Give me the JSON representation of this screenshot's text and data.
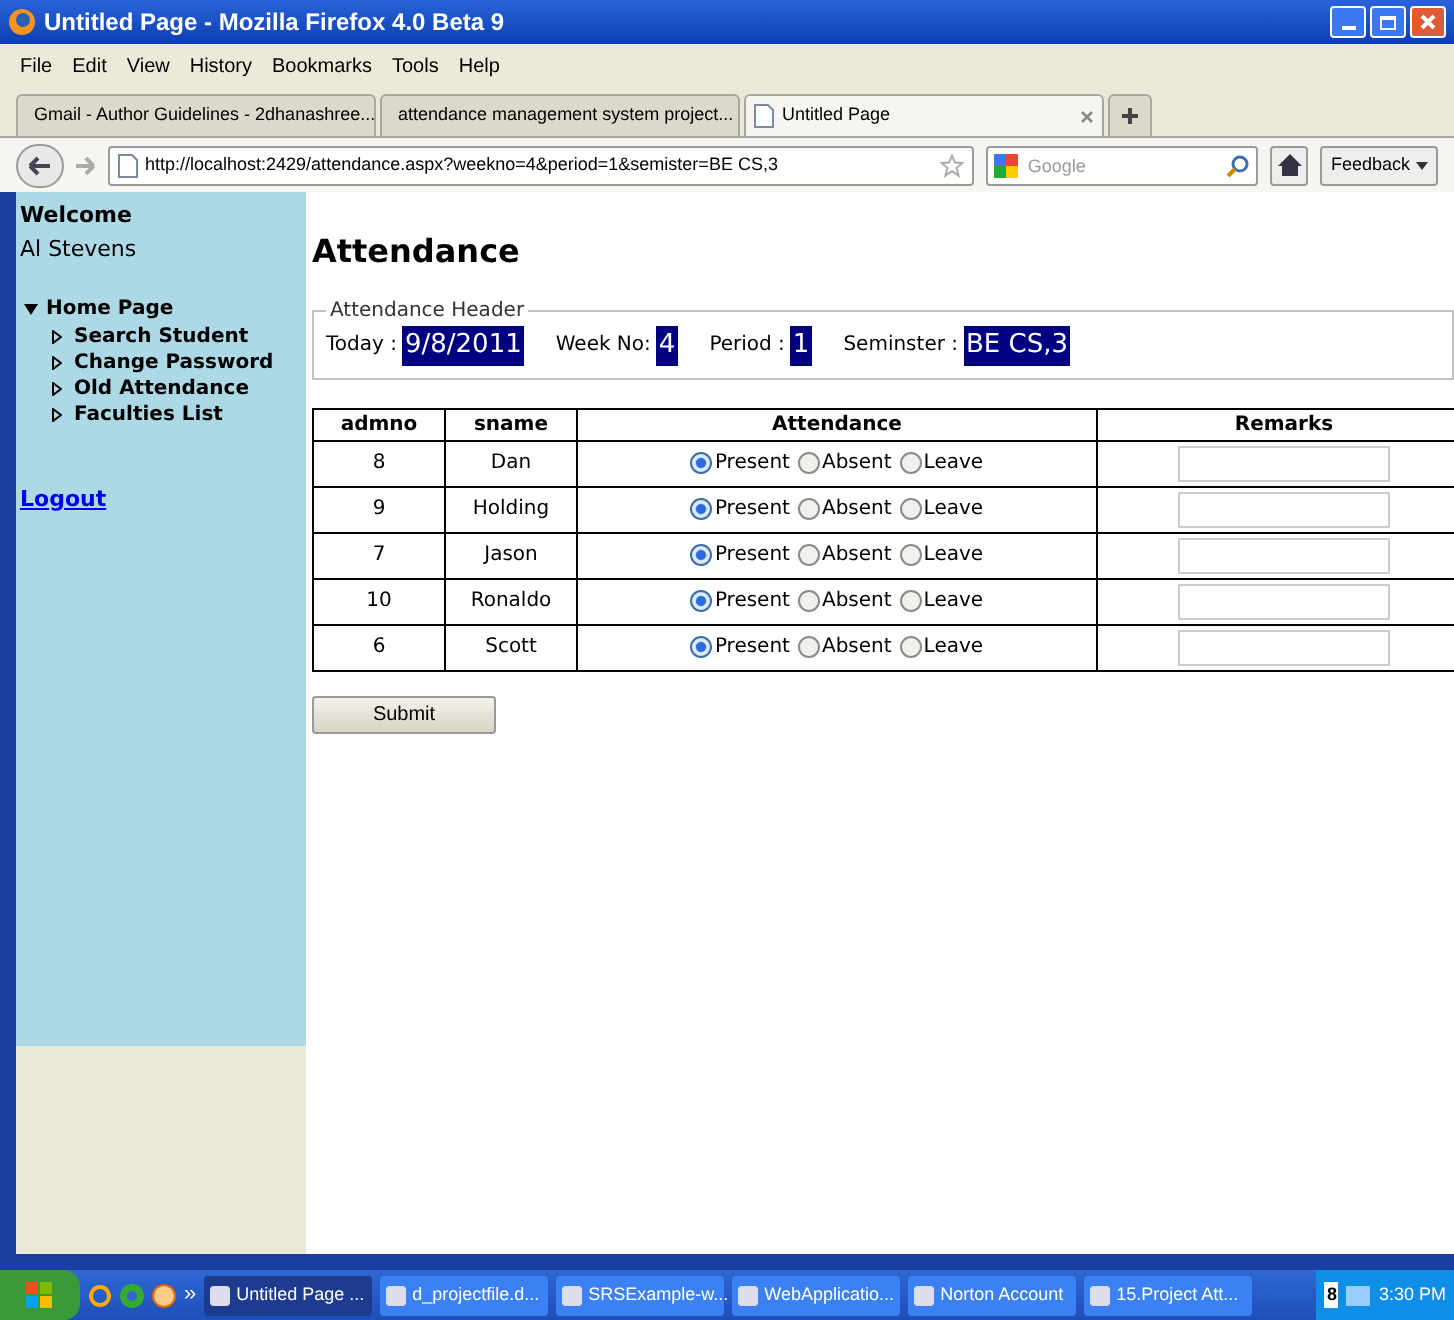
{
  "window": {
    "title": "Untitled Page - Mozilla Firefox 4.0 Beta 9"
  },
  "menu": [
    "File",
    "Edit",
    "View",
    "History",
    "Bookmarks",
    "Tools",
    "Help"
  ],
  "tabs": [
    {
      "label": "Gmail - Author Guidelines - 2dhanashree...",
      "selected": false
    },
    {
      "label": "attendance management system project...",
      "selected": false
    },
    {
      "label": "Untitled Page",
      "selected": true
    }
  ],
  "address": "http://localhost:2429/attendance.aspx?weekno=4&period=1&semister=BE CS,3",
  "search": {
    "placeholder": "Google"
  },
  "feedback": "Feedback",
  "sidebar": {
    "welcome": "Welcome",
    "user": "Al Stevens",
    "root": {
      "label": "Home Page",
      "expanded": true,
      "children": [
        "Search Student",
        "Change Password",
        "Old Attendance",
        "Faculties List"
      ]
    },
    "logout": "Logout"
  },
  "heading": "Attendance",
  "header_box": {
    "legend": "Attendance Header",
    "fields": [
      {
        "label": "Today :",
        "value": "9/8/2011"
      },
      {
        "label": "Week No:",
        "value": "4"
      },
      {
        "label": "Period :",
        "value": "1"
      },
      {
        "label": "Seminster :",
        "value": "BE CS,3"
      }
    ]
  },
  "table": {
    "columns": [
      "admno",
      "sname",
      "Attendance",
      "Remarks"
    ],
    "rows": [
      {
        "admno": "8",
        "sname": "Dan",
        "options": [
          {
            "label": "Present",
            "selected": true
          },
          {
            "label": "Absent",
            "selected": false
          },
          {
            "label": "Leave",
            "selected": false
          }
        ]
      },
      {
        "admno": "9",
        "sname": "Holding",
        "options": [
          {
            "label": "Present",
            "selected": true
          },
          {
            "label": "Absent",
            "selected": false
          },
          {
            "label": "Leave",
            "selected": false
          }
        ]
      },
      {
        "admno": "7",
        "sname": "Jason",
        "options": [
          {
            "label": "Present",
            "selected": true
          },
          {
            "label": "Absent",
            "selected": false
          },
          {
            "label": "Leave",
            "selected": false
          }
        ]
      },
      {
        "admno": "10",
        "sname": "Ronaldo",
        "options": [
          {
            "label": "Present",
            "selected": true
          },
          {
            "label": "Absent",
            "selected": false
          },
          {
            "label": "Leave",
            "selected": false
          }
        ]
      },
      {
        "admno": "6",
        "sname": "Scott",
        "options": [
          {
            "label": "Present",
            "selected": true
          },
          {
            "label": "Absent",
            "selected": false
          },
          {
            "label": "Leave",
            "selected": false
          }
        ]
      }
    ]
  },
  "submit": "Submit",
  "taskbar": {
    "overflow": "»",
    "tasks": [
      {
        "label": "Untitled Page ...",
        "selected": true
      },
      {
        "label": "d_projectfile.d...",
        "selected": false
      },
      {
        "label": "SRSExample-w...",
        "selected": false
      },
      {
        "label": "WebApplicatio...",
        "selected": false
      },
      {
        "label": "Norton Account",
        "selected": false
      },
      {
        "label": "15.Project Att...",
        "selected": false
      }
    ],
    "tray_badge": "8",
    "time": "3:30 PM"
  }
}
